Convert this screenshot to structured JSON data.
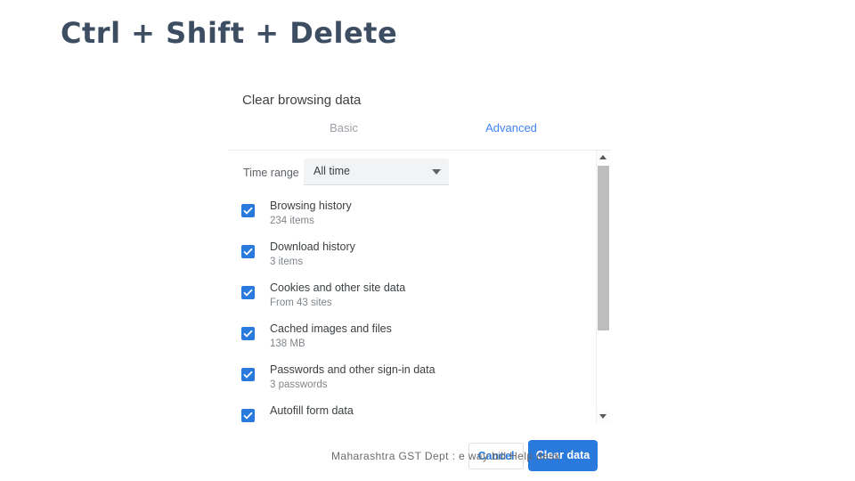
{
  "slide": {
    "title": "Ctrl + Shift + Delete",
    "watermark": "Maharashtra GST Dept : e way bill Help desk"
  },
  "dialog": {
    "title": "Clear browsing data",
    "tabs": [
      {
        "label": "Basic",
        "active": false
      },
      {
        "label": "Advanced",
        "active": true
      }
    ],
    "time_range": {
      "label": "Time range",
      "value": "All time",
      "icon": "chevron-down-icon"
    },
    "items": [
      {
        "label": "Browsing history",
        "sub": "234 items",
        "checked": true
      },
      {
        "label": "Download history",
        "sub": "3 items",
        "checked": true
      },
      {
        "label": "Cookies and other site data",
        "sub": "From 43 sites",
        "checked": true
      },
      {
        "label": "Cached images and files",
        "sub": "138 MB",
        "checked": true
      },
      {
        "label": "Passwords and other sign-in data",
        "sub": "3 passwords",
        "checked": true
      },
      {
        "label": "Autofill form data",
        "sub": "",
        "checked": true
      }
    ],
    "buttons": {
      "cancel": "Cancel",
      "clear": "Clear data"
    },
    "scrollbar": {
      "up_icon": "scroll-up-arrow-icon",
      "down_icon": "scroll-down-arrow-icon"
    }
  },
  "colors": {
    "accent_blue": "#2a7ade",
    "tab_active": "#4285f4",
    "tab_inactive": "#9aa0a6",
    "title_slate": "#3d4e63",
    "text_primary": "#3c4043",
    "text_secondary": "#80868b"
  }
}
